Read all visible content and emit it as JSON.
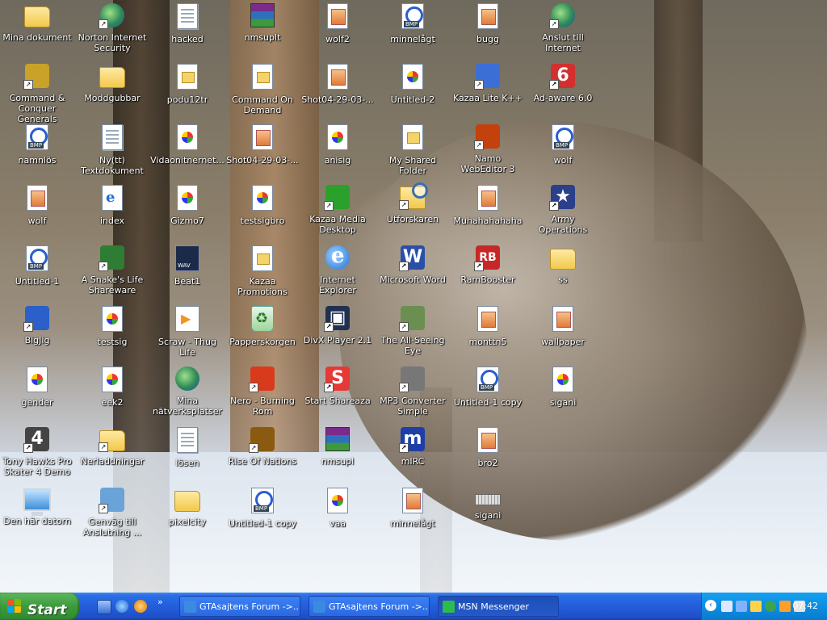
{
  "desktop": {
    "icons": [
      {
        "label": "Mina dokument",
        "icon": "my-documents-folder-icon",
        "shortcut": false
      },
      {
        "label": "Command & Conquer Generals",
        "icon": "command-conquer-generals-icon",
        "shortcut": true
      },
      {
        "label": "namnlös",
        "icon": "bmp-file-icon",
        "shortcut": false
      },
      {
        "label": "wolf",
        "icon": "jpg-image-icon",
        "shortcut": false
      },
      {
        "label": "Untitled-1",
        "icon": "bmp-file-icon",
        "shortcut": false
      },
      {
        "label": "BigJig",
        "icon": "bigjig-app-icon",
        "shortcut": true
      },
      {
        "label": "gender",
        "icon": "image-file-icon",
        "shortcut": false
      },
      {
        "label": "Tony Hawks Pro Skater 4 Demo",
        "icon": "thps4-icon",
        "shortcut": true
      },
      {
        "label": "Den här datorn",
        "icon": "my-computer-icon",
        "shortcut": false
      },
      {
        "label": "Norton Internet Security",
        "icon": "norton-globe-icon",
        "shortcut": true
      },
      {
        "label": "Moddgubbar",
        "icon": "folder-icon",
        "shortcut": false
      },
      {
        "label": "Ny(tt) Textdokument",
        "icon": "text-document-icon",
        "shortcut": false
      },
      {
        "label": "index",
        "icon": "html-file-icon",
        "shortcut": false
      },
      {
        "label": "A Snake's Life Shareware",
        "icon": "snake-game-icon",
        "shortcut": true
      },
      {
        "label": "testsig",
        "icon": "image-file-icon",
        "shortcut": false
      },
      {
        "label": "eek2",
        "icon": "image-file-icon",
        "shortcut": false
      },
      {
        "label": "Nerladdningar",
        "icon": "downloads-folder-icon",
        "shortcut": true
      },
      {
        "label": "Genväg till Anslutning ...",
        "icon": "network-connection-icon",
        "shortcut": true
      },
      {
        "label": "hacked",
        "icon": "text-document-icon",
        "shortcut": false
      },
      {
        "label": "podu12tr",
        "icon": "generic-file-icon",
        "shortcut": false
      },
      {
        "label": "Vidaonitnernet...",
        "icon": "image-file-icon",
        "shortcut": false
      },
      {
        "label": "Gizmo7",
        "icon": "image-file-icon",
        "shortcut": false
      },
      {
        "label": "Beat1",
        "icon": "wav-file-icon",
        "shortcut": false
      },
      {
        "label": "Scraw - Thug Life",
        "icon": "media-file-icon",
        "shortcut": false
      },
      {
        "label": "Mina nätverksplatser",
        "icon": "network-places-icon",
        "shortcut": false
      },
      {
        "label": "lösen",
        "icon": "text-document-icon",
        "shortcut": false
      },
      {
        "label": "pixelcity",
        "icon": "folder-icon",
        "shortcut": false
      },
      {
        "label": "nmsuplt",
        "icon": "rar-archive-icon",
        "shortcut": false
      },
      {
        "label": "Command On Demand",
        "icon": "generic-file-icon",
        "shortcut": false
      },
      {
        "label": "Shot04-29-03-...",
        "icon": "jpg-image-icon",
        "shortcut": false
      },
      {
        "label": "testsigbro",
        "icon": "image-file-icon",
        "shortcut": false
      },
      {
        "label": "Kazaa Promotions",
        "icon": "generic-file-icon",
        "shortcut": false
      },
      {
        "label": "Papperskorgen",
        "icon": "recycle-bin-icon",
        "shortcut": false
      },
      {
        "label": "Nero - Burning Rom",
        "icon": "nero-icon",
        "shortcut": true
      },
      {
        "label": "Rise Of Nations",
        "icon": "rise-of-nations-icon",
        "shortcut": true
      },
      {
        "label": "Untitled-1 copy",
        "icon": "bmp-file-icon",
        "shortcut": false
      },
      {
        "label": "wolf2",
        "icon": "jpg-image-icon",
        "shortcut": false
      },
      {
        "label": "Shot04-29-03-...",
        "icon": "jpg-image-icon",
        "shortcut": false
      },
      {
        "label": "anisig",
        "icon": "image-file-icon",
        "shortcut": false
      },
      {
        "label": "Kazaa Media Desktop",
        "icon": "kazaa-icon",
        "shortcut": true
      },
      {
        "label": "Internet Explorer",
        "icon": "internet-explorer-icon",
        "shortcut": false
      },
      {
        "label": "DivX Player 2.1",
        "icon": "divx-player-icon",
        "shortcut": true
      },
      {
        "label": "Start Shareaza",
        "icon": "shareaza-icon",
        "shortcut": true
      },
      {
        "label": "nmsupl",
        "icon": "rar-archive-icon",
        "shortcut": false
      },
      {
        "label": "vaa",
        "icon": "image-file-icon",
        "shortcut": false
      },
      {
        "label": "minnelågt",
        "icon": "bmp-file-icon",
        "shortcut": false
      },
      {
        "label": "Untitled-2",
        "icon": "image-file-icon",
        "shortcut": false
      },
      {
        "label": "My Shared Folder",
        "icon": "generic-file-icon",
        "shortcut": false
      },
      {
        "label": "Utforskaren",
        "icon": "explorer-icon",
        "shortcut": true
      },
      {
        "label": "Microsoft Word",
        "icon": "microsoft-word-icon",
        "shortcut": true
      },
      {
        "label": "The All-Seeing Eye",
        "icon": "all-seeing-eye-icon",
        "shortcut": true
      },
      {
        "label": "MP3 Converter Simple",
        "icon": "mp3-converter-icon",
        "shortcut": true
      },
      {
        "label": "mIRC",
        "icon": "mirc-icon",
        "shortcut": true
      },
      {
        "label": "minnelågt",
        "icon": "jpg-image-icon",
        "shortcut": false
      },
      {
        "label": "bugg",
        "icon": "jpg-image-icon",
        "shortcut": false
      },
      {
        "label": "Kazaa Lite K++",
        "icon": "kazaa-lite-icon",
        "shortcut": true
      },
      {
        "label": "Namo WebEditor 3",
        "icon": "namo-webeditor-icon",
        "shortcut": true
      },
      {
        "label": "Muhahahahaha",
        "icon": "jpg-image-icon",
        "shortcut": false
      },
      {
        "label": "RamBooster",
        "icon": "rambooster-icon",
        "shortcut": true
      },
      {
        "label": "monttn5",
        "icon": "jpg-image-icon",
        "shortcut": false
      },
      {
        "label": "Untitled-1 copy",
        "icon": "bmp-file-icon",
        "shortcut": false
      },
      {
        "label": "bro2",
        "icon": "jpg-image-icon",
        "shortcut": false
      },
      {
        "label": "sigani",
        "icon": "keyboard-icon",
        "shortcut": false
      },
      {
        "label": "Anslut till Internet",
        "icon": "connect-internet-icon",
        "shortcut": true
      },
      {
        "label": "Ad-aware 6.0",
        "icon": "ad-aware-icon",
        "shortcut": true
      },
      {
        "label": "wolf",
        "icon": "bmp-file-icon",
        "shortcut": false
      },
      {
        "label": "Army Operations",
        "icon": "army-operations-icon",
        "shortcut": true
      },
      {
        "label": "ss",
        "icon": "folder-icon",
        "shortcut": false
      },
      {
        "label": "wallpaper",
        "icon": "jpg-image-icon",
        "shortcut": false
      },
      {
        "label": "sigani",
        "icon": "image-file-icon",
        "shortcut": false
      }
    ]
  },
  "taskbar": {
    "start_label": "Start",
    "tasks": [
      {
        "label": "GTAsajtens Forum ->...",
        "icon": "browser-window-icon",
        "active": false
      },
      {
        "label": "GTAsajtens Forum ->...",
        "icon": "browser-window-icon",
        "active": false
      },
      {
        "label": "MSN Messenger",
        "icon": "msn-messenger-icon",
        "active": true
      }
    ],
    "quick_launch": [
      "show-desktop-icon",
      "internet-explorer-icon",
      "windows-media-icon"
    ],
    "tray_icons": [
      "volume-icon",
      "network-icon",
      "messenger-icon",
      "norton-icon",
      "kazaa-tray-icon",
      "update-icon"
    ],
    "clock": "07:42"
  },
  "colors": {
    "taskbar": "#245edb",
    "start_button": "#3c9b3c",
    "tray": "#0c8ee0"
  }
}
